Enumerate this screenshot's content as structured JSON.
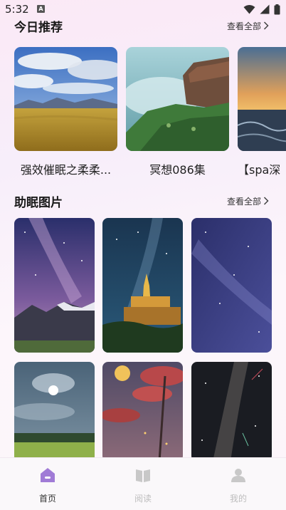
{
  "status": {
    "time": "5:32",
    "notif": "A"
  },
  "recommend": {
    "title": "今日推荐",
    "see_all": "查看全部",
    "items": [
      {
        "label": "强效催眠之柔柔..."
      },
      {
        "label": "冥想086集"
      },
      {
        "label": "【spa深"
      }
    ]
  },
  "gallery": {
    "title": "助眠图片",
    "see_all": "查看全部"
  },
  "tabs": [
    {
      "label": "首页",
      "active": true
    },
    {
      "label": "阅读",
      "active": false
    },
    {
      "label": "我的",
      "active": false
    }
  ],
  "colors": {
    "accent": "#a07bd6",
    "inactive": "#c8c8c8"
  }
}
